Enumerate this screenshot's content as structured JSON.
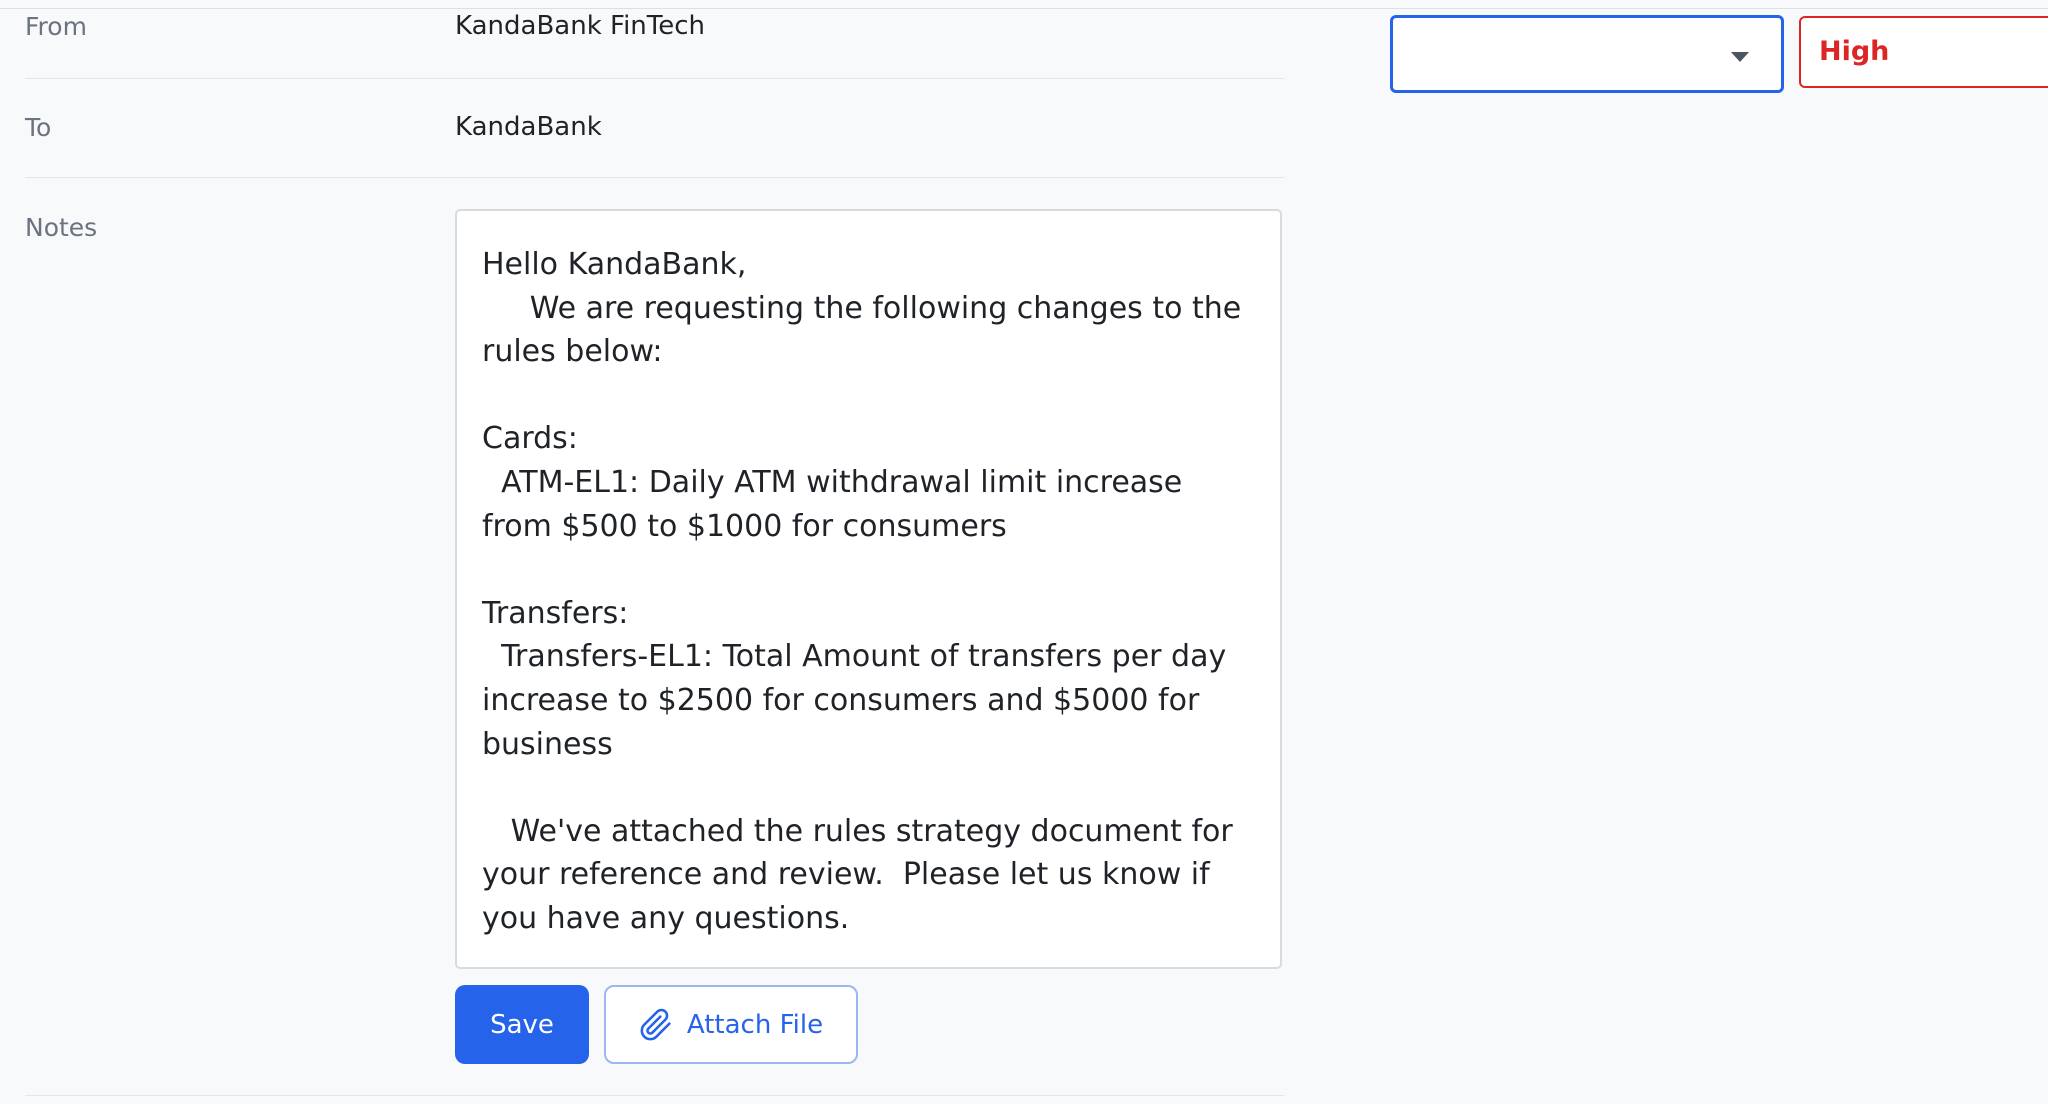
{
  "form": {
    "from_label": "From",
    "from_value": "KandaBank FinTech",
    "to_label": "To",
    "to_value": "KandaBank",
    "notes_label": "Notes",
    "notes_value": "Hello KandaBank,\n     We are requesting the following changes to the rules below:\n\nCards:\n  ATM-EL1: Daily ATM withdrawal limit increase from $500 to $1000 for consumers\n\nTransfers:\n  Transfers-EL1: Total Amount of transfers per day increase to $2500 for consumers and $5000 for business\n\n   We've attached the rules strategy document for your reference and review.  Please let us know if you have any questions."
  },
  "actions": {
    "save_label": "Save",
    "attach_label": "Attach File",
    "attach_icon": "paperclip-icon"
  },
  "sidebar": {
    "select_value": "",
    "select_icon": "chevron-down-icon",
    "priority_value": "High",
    "priority_color": "#dc2626",
    "accent_color": "#2563eb"
  }
}
